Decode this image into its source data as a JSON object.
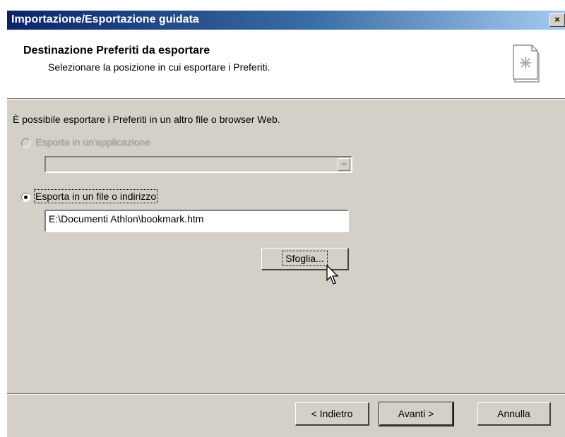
{
  "window": {
    "title": "Importazione/Esportazione guidata",
    "close_label": "×"
  },
  "header": {
    "title": "Destinazione Preferiti da esportare",
    "subtitle": "Selezionare la posizione in cui esportare i Preferiti.",
    "icon": "wizard-document-icon"
  },
  "body": {
    "intro": "È possibile esportare i Preferiti in un altro file o browser Web.",
    "option_app": {
      "label": "Esporta in un'applicazione",
      "selected": false,
      "enabled": false,
      "combo_value": ""
    },
    "option_file": {
      "label": "Esporta in un file o indirizzo",
      "selected": true,
      "enabled": true,
      "path_value": "E:\\Documenti Athlon\\bookmark.htm"
    },
    "browse_label": "Sfoglia..."
  },
  "footer": {
    "back_label": "< Indietro",
    "next_label": "Avanti >",
    "cancel_label": "Annulla"
  },
  "colors": {
    "title_gradient_start": "#0a246a",
    "title_gradient_end": "#a6caf0",
    "face": "#d4d0c8"
  }
}
